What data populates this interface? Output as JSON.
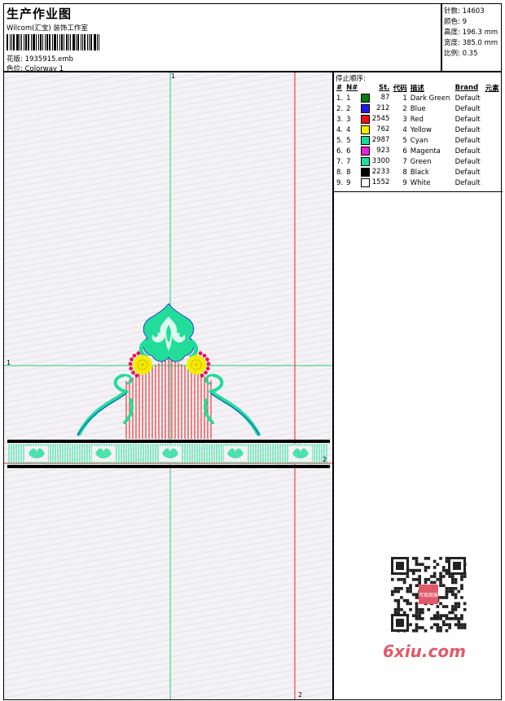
{
  "header": {
    "title": "生产作业图",
    "subtitle": "Wilcom(汇宝) 装饰工作室",
    "design_line": "花版:  1935915.emb",
    "colorway_line": "色位:  Colorway 1"
  },
  "stats": {
    "stitches": "针数: 14603",
    "colors": "颜色: 9",
    "height": "高度: 196.3 mm",
    "width": "宽度: 385.0 mm",
    "scale": "比例: 0.35"
  },
  "stop_sequence": {
    "title": "停止顺序:",
    "headers": [
      "#",
      "N#",
      "St.",
      "代码",
      "描述",
      "Brand",
      "元素"
    ],
    "rows": [
      {
        "idx": "1.",
        "n": "1",
        "color": "#0a7a12",
        "st": "87",
        "code": "1",
        "desc": "Dark Green",
        "brand": "Default"
      },
      {
        "idx": "2.",
        "n": "2",
        "color": "#1a1aee",
        "st": "212",
        "code": "2",
        "desc": "Blue",
        "brand": "Default"
      },
      {
        "idx": "3.",
        "n": "3",
        "color": "#ee1111",
        "st": "2545",
        "code": "3",
        "desc": "Red",
        "brand": "Default"
      },
      {
        "idx": "4.",
        "n": "4",
        "color": "#f2ee00",
        "st": "762",
        "code": "4",
        "desc": "Yellow",
        "brand": "Default"
      },
      {
        "idx": "5.",
        "n": "5",
        "color": "#1ed89a",
        "st": "2987",
        "code": "5",
        "desc": "Cyan",
        "brand": "Default"
      },
      {
        "idx": "6.",
        "n": "6",
        "color": "#e81ee0",
        "st": "923",
        "code": "6",
        "desc": "Magenta",
        "brand": "Default"
      },
      {
        "idx": "7.",
        "n": "7",
        "color": "#22dd99",
        "st": "3300",
        "code": "7",
        "desc": "Green",
        "brand": "Default"
      },
      {
        "idx": "8.",
        "n": "8",
        "color": "#000000",
        "st": "2233",
        "code": "8",
        "desc": "Black",
        "brand": "Default"
      },
      {
        "idx": "9.",
        "n": "9",
        "color": "#ffffff",
        "st": "1552",
        "code": "9",
        "desc": "White",
        "brand": "Default"
      }
    ]
  },
  "axes": {
    "v_green_top": "1",
    "h_green_left": "1",
    "h_red_right": "2",
    "v_red_bottom": "2"
  },
  "watermark": {
    "text": "6xiu.com",
    "seal": "可商图案"
  },
  "colors": {
    "guide_green": "#22cc77",
    "guide_red": "#ee2222",
    "jade": "#22dd99",
    "red": "#ee1111",
    "yellow": "#f2ee00",
    "magenta": "#e81ee0",
    "black": "#000000",
    "blue": "#1a1aee"
  }
}
